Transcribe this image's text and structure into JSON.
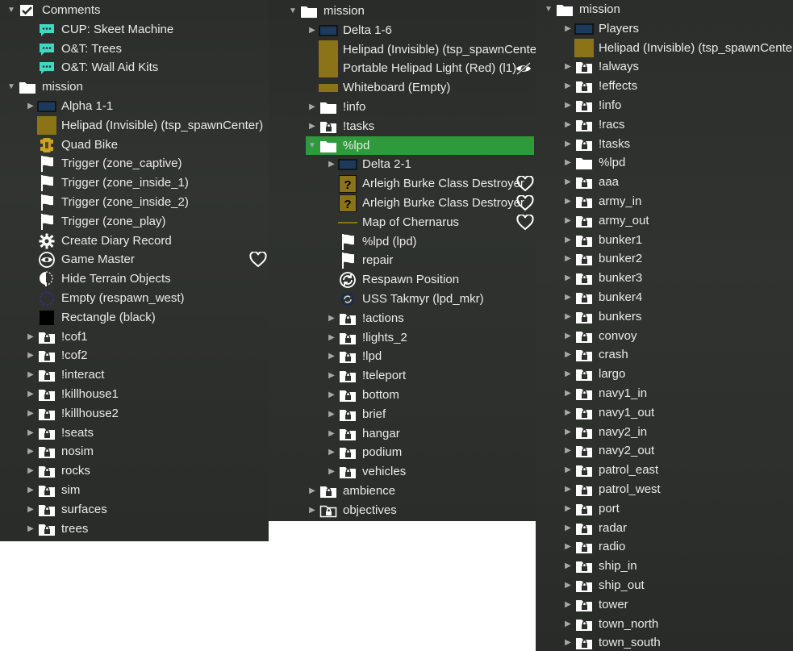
{
  "panels": [
    {
      "rows": [
        {
          "label": "Comments",
          "icon": "checkbox-icon",
          "toggle": "expanded",
          "indent": 0
        },
        {
          "label": "CUP: Skeet Machine",
          "icon": "comment-icon",
          "toggle": "none",
          "indent": 1
        },
        {
          "label": "O&T: Trees",
          "icon": "comment-icon",
          "toggle": "none",
          "indent": 1
        },
        {
          "label": "O&T: Wall Aid Kits",
          "icon": "comment-icon",
          "toggle": "none",
          "indent": 1
        },
        {
          "label": "mission",
          "icon": "folder-icon",
          "toggle": "expanded",
          "indent": 0
        },
        {
          "label": "Alpha 1-1",
          "icon": "group-icon",
          "toggle": "collapsed",
          "indent": 1
        },
        {
          "label": "Helipad (Invisible) (tsp_spawnCenter)",
          "icon": "helipad-icon",
          "toggle": "none",
          "indent": 1
        },
        {
          "label": "Quad Bike",
          "icon": "quad-bike-icon",
          "toggle": "none",
          "indent": 1
        },
        {
          "label": "Trigger (zone_captive)",
          "icon": "trigger-flag-icon",
          "toggle": "none",
          "indent": 1
        },
        {
          "label": "Trigger (zone_inside_1)",
          "icon": "trigger-flag-icon",
          "toggle": "none",
          "indent": 1
        },
        {
          "label": "Trigger (zone_inside_2)",
          "icon": "trigger-flag-icon",
          "toggle": "none",
          "indent": 1
        },
        {
          "label": "Trigger (zone_play)",
          "icon": "trigger-flag-icon",
          "toggle": "none",
          "indent": 1
        },
        {
          "label": "Create Diary Record",
          "icon": "gear-icon",
          "toggle": "none",
          "indent": 1
        },
        {
          "label": "Game Master",
          "icon": "eye-module-icon",
          "toggle": "none",
          "indent": 1,
          "heart": true
        },
        {
          "label": "Hide Terrain Objects",
          "icon": "hide-terrain-icon",
          "toggle": "none",
          "indent": 1
        },
        {
          "label": "Empty (respawn_west)",
          "icon": "empty-marker-icon",
          "toggle": "none",
          "indent": 1
        },
        {
          "label": "Rectangle (black)",
          "icon": "rectangle-black-icon",
          "toggle": "none",
          "indent": 1
        },
        {
          "label": "!cof1",
          "icon": "locked-folder-icon",
          "toggle": "collapsed",
          "indent": 1
        },
        {
          "label": "!cof2",
          "icon": "locked-folder-icon",
          "toggle": "collapsed",
          "indent": 1
        },
        {
          "label": "!interact",
          "icon": "locked-folder-icon",
          "toggle": "collapsed",
          "indent": 1
        },
        {
          "label": "!killhouse1",
          "icon": "locked-folder-icon",
          "toggle": "collapsed",
          "indent": 1
        },
        {
          "label": "!killhouse2",
          "icon": "locked-folder-icon",
          "toggle": "collapsed",
          "indent": 1
        },
        {
          "label": "!seats",
          "icon": "locked-folder-icon",
          "toggle": "collapsed",
          "indent": 1
        },
        {
          "label": "nosim",
          "icon": "locked-folder-icon",
          "toggle": "collapsed",
          "indent": 1
        },
        {
          "label": "rocks",
          "icon": "locked-folder-icon",
          "toggle": "collapsed",
          "indent": 1
        },
        {
          "label": "sim",
          "icon": "locked-folder-icon",
          "toggle": "collapsed",
          "indent": 1
        },
        {
          "label": "surfaces",
          "icon": "locked-folder-icon",
          "toggle": "collapsed",
          "indent": 1
        },
        {
          "label": "trees",
          "icon": "locked-folder-icon",
          "toggle": "collapsed",
          "indent": 1
        }
      ]
    },
    {
      "rows": [
        {
          "label": "mission",
          "icon": "folder-icon",
          "toggle": "expanded",
          "indent": 0
        },
        {
          "label": "Delta 1-6",
          "icon": "group-icon",
          "toggle": "collapsed",
          "indent": 1
        },
        {
          "label": "Helipad (Invisible) (tsp_spawnCenter)",
          "icon": "helipad-icon",
          "toggle": "none",
          "indent": 1
        },
        {
          "label": "Portable Helipad Light (Red) (l1)",
          "icon": "helipad-icon",
          "toggle": "none",
          "indent": 1,
          "hidden_eye": true
        },
        {
          "label": "Whiteboard (Empty)",
          "icon": "whiteboard-icon",
          "toggle": "none",
          "indent": 1
        },
        {
          "label": "!info",
          "icon": "folder-icon",
          "toggle": "collapsed",
          "indent": 1
        },
        {
          "label": "!tasks",
          "icon": "locked-folder-icon",
          "toggle": "collapsed",
          "indent": 1
        },
        {
          "label": "%lpd",
          "icon": "folder-icon",
          "toggle": "expanded",
          "indent": 1,
          "selected": true
        },
        {
          "label": "Delta 2-1",
          "icon": "group-icon",
          "toggle": "collapsed",
          "indent": 2
        },
        {
          "label": "Arleigh Burke Class Destroyer",
          "icon": "unknown-object-icon",
          "toggle": "none",
          "indent": 2,
          "heart": true
        },
        {
          "label": "Arleigh Burke Class Destroyer",
          "icon": "unknown-object-icon",
          "toggle": "none",
          "indent": 2,
          "heart": true
        },
        {
          "label": "Map of Chernarus",
          "icon": "line-icon",
          "toggle": "none",
          "indent": 2,
          "heart": true
        },
        {
          "label": "%lpd (lpd)",
          "icon": "trigger-flag-icon",
          "toggle": "none",
          "indent": 2
        },
        {
          "label": "repair",
          "icon": "trigger-flag-icon",
          "toggle": "none",
          "indent": 2
        },
        {
          "label": "Respawn Position",
          "icon": "respawn-icon",
          "toggle": "none",
          "indent": 2
        },
        {
          "label": "USS Takmyr (lpd_mkr)",
          "icon": "marker-icon",
          "toggle": "none",
          "indent": 2
        },
        {
          "label": "!actions",
          "icon": "locked-folder-icon",
          "toggle": "collapsed",
          "indent": 2
        },
        {
          "label": "!lights_2",
          "icon": "locked-folder-icon",
          "toggle": "collapsed",
          "indent": 2
        },
        {
          "label": "!lpd",
          "icon": "locked-folder-icon",
          "toggle": "collapsed",
          "indent": 2
        },
        {
          "label": "!teleport",
          "icon": "locked-folder-icon",
          "toggle": "collapsed",
          "indent": 2
        },
        {
          "label": "bottom",
          "icon": "locked-folder-icon",
          "toggle": "collapsed",
          "indent": 2
        },
        {
          "label": "brief",
          "icon": "locked-folder-icon",
          "toggle": "collapsed",
          "indent": 2
        },
        {
          "label": "hangar",
          "icon": "locked-folder-icon",
          "toggle": "collapsed",
          "indent": 2
        },
        {
          "label": "podium",
          "icon": "locked-folder-icon",
          "toggle": "collapsed",
          "indent": 2
        },
        {
          "label": "vehicles",
          "icon": "locked-folder-icon",
          "toggle": "collapsed",
          "indent": 2
        },
        {
          "label": "ambience",
          "icon": "locked-folder-icon",
          "toggle": "collapsed",
          "indent": 1
        },
        {
          "label": "objectives",
          "icon": "outline-locked-folder-icon",
          "toggle": "collapsed",
          "indent": 1
        }
      ]
    },
    {
      "rows": [
        {
          "label": "mission",
          "icon": "folder-icon",
          "toggle": "expanded",
          "indent": 0
        },
        {
          "label": "Players",
          "icon": "group-icon",
          "toggle": "collapsed",
          "indent": 1
        },
        {
          "label": "Helipad (Invisible) (tsp_spawnCenter)",
          "icon": "helipad-icon",
          "toggle": "none",
          "indent": 1
        },
        {
          "label": "!always",
          "icon": "locked-folder-icon",
          "toggle": "collapsed",
          "indent": 1
        },
        {
          "label": "!effects",
          "icon": "locked-folder-icon",
          "toggle": "collapsed",
          "indent": 1
        },
        {
          "label": "!info",
          "icon": "locked-folder-icon",
          "toggle": "collapsed",
          "indent": 1
        },
        {
          "label": "!racs",
          "icon": "locked-folder-icon",
          "toggle": "collapsed",
          "indent": 1
        },
        {
          "label": "!tasks",
          "icon": "locked-folder-icon",
          "toggle": "collapsed",
          "indent": 1
        },
        {
          "label": "%lpd",
          "icon": "folder-icon",
          "toggle": "collapsed",
          "indent": 1
        },
        {
          "label": "aaa",
          "icon": "locked-folder-icon",
          "toggle": "collapsed",
          "indent": 1
        },
        {
          "label": "army_in",
          "icon": "locked-folder-icon",
          "toggle": "collapsed",
          "indent": 1
        },
        {
          "label": "army_out",
          "icon": "locked-folder-icon",
          "toggle": "collapsed",
          "indent": 1
        },
        {
          "label": "bunker1",
          "icon": "locked-folder-icon",
          "toggle": "collapsed",
          "indent": 1
        },
        {
          "label": "bunker2",
          "icon": "locked-folder-icon",
          "toggle": "collapsed",
          "indent": 1
        },
        {
          "label": "bunker3",
          "icon": "locked-folder-icon",
          "toggle": "collapsed",
          "indent": 1
        },
        {
          "label": "bunker4",
          "icon": "locked-folder-icon",
          "toggle": "collapsed",
          "indent": 1
        },
        {
          "label": "bunkers",
          "icon": "locked-folder-icon",
          "toggle": "collapsed",
          "indent": 1
        },
        {
          "label": "convoy",
          "icon": "locked-folder-icon",
          "toggle": "collapsed",
          "indent": 1
        },
        {
          "label": "crash",
          "icon": "locked-folder-icon",
          "toggle": "collapsed",
          "indent": 1
        },
        {
          "label": "largo",
          "icon": "locked-folder-icon",
          "toggle": "collapsed",
          "indent": 1
        },
        {
          "label": "navy1_in",
          "icon": "locked-folder-icon",
          "toggle": "collapsed",
          "indent": 1
        },
        {
          "label": "navy1_out",
          "icon": "locked-folder-icon",
          "toggle": "collapsed",
          "indent": 1
        },
        {
          "label": "navy2_in",
          "icon": "locked-folder-icon",
          "toggle": "collapsed",
          "indent": 1
        },
        {
          "label": "navy2_out",
          "icon": "locked-folder-icon",
          "toggle": "collapsed",
          "indent": 1
        },
        {
          "label": "patrol_east",
          "icon": "locked-folder-icon",
          "toggle": "collapsed",
          "indent": 1
        },
        {
          "label": "patrol_west",
          "icon": "locked-folder-icon",
          "toggle": "collapsed",
          "indent": 1
        },
        {
          "label": "port",
          "icon": "locked-folder-icon",
          "toggle": "collapsed",
          "indent": 1
        },
        {
          "label": "radar",
          "icon": "locked-folder-icon",
          "toggle": "collapsed",
          "indent": 1
        },
        {
          "label": "radio",
          "icon": "locked-folder-icon",
          "toggle": "collapsed",
          "indent": 1
        },
        {
          "label": "ship_in",
          "icon": "locked-folder-icon",
          "toggle": "collapsed",
          "indent": 1
        },
        {
          "label": "ship_out",
          "icon": "locked-folder-icon",
          "toggle": "collapsed",
          "indent": 1
        },
        {
          "label": "tower",
          "icon": "locked-folder-icon",
          "toggle": "collapsed",
          "indent": 1
        },
        {
          "label": "town_north",
          "icon": "locked-folder-icon",
          "toggle": "collapsed",
          "indent": 1
        },
        {
          "label": "town_south",
          "icon": "locked-folder-icon",
          "toggle": "collapsed",
          "indent": 1
        }
      ]
    }
  ],
  "colors": {
    "selected": "#2e9a3c",
    "comment": "#3fd9c1",
    "helipad": "#8a7417",
    "group": "#1d3a5c",
    "unknown": "#8a7417"
  }
}
